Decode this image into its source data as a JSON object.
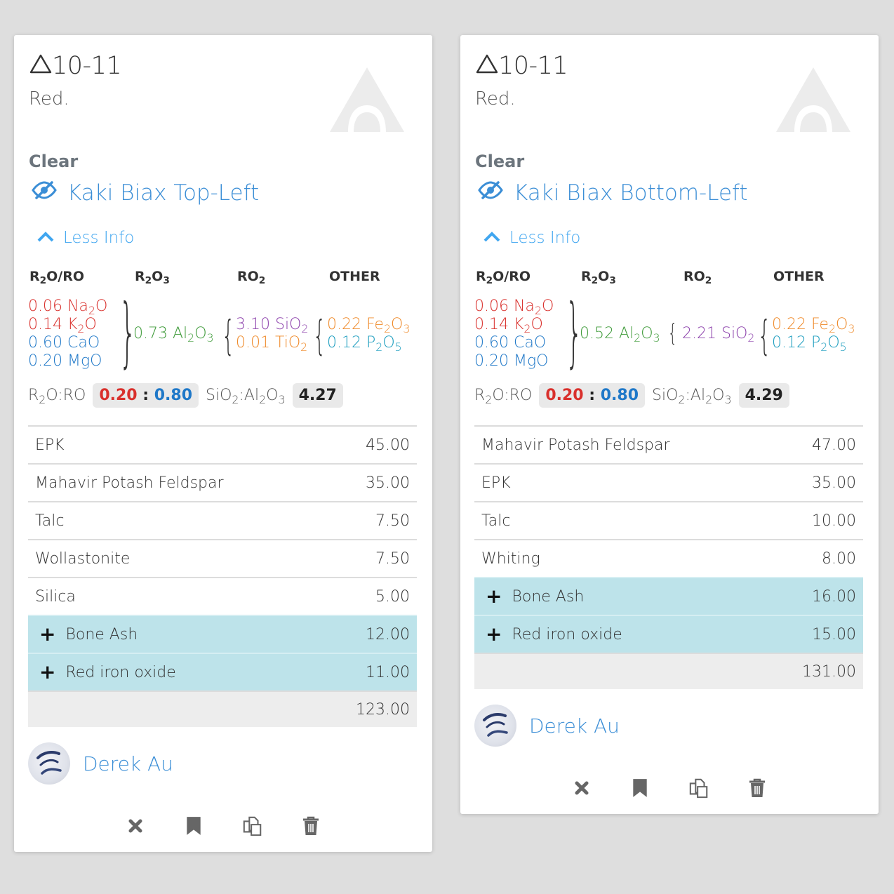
{
  "cards": [
    {
      "cone": "10-11",
      "atmosphere": "Red.",
      "finish": "Clear",
      "name": "Kaki Biax Top-Left",
      "less_info": "Less Info",
      "umf_headers": [
        "R2O/RO",
        "R2O3",
        "RO2",
        "OTHER"
      ],
      "flux": [
        {
          "amount": "0.06",
          "oxide": "Na2O"
        },
        {
          "amount": "0.14",
          "oxide": "K2O"
        },
        {
          "amount": "0.60",
          "oxide": "CaO"
        },
        {
          "amount": "0.20",
          "oxide": "MgO"
        }
      ],
      "r2o3": [
        {
          "amount": "0.73",
          "oxide": "Al2O3"
        }
      ],
      "ro2": [
        {
          "amount": "3.10",
          "oxide": "SiO2"
        },
        {
          "amount": "0.01",
          "oxide": "TiO2"
        }
      ],
      "other": [
        {
          "amount": "0.22",
          "oxide": "Fe2O3"
        },
        {
          "amount": "0.12",
          "oxide": "P2O5"
        }
      ],
      "r2o_ro_label": "R2O:RO",
      "r2o": "0.20",
      "ro": "0.80",
      "si_al_label": "SiO2:Al2O3",
      "si_al": "4.27",
      "materials": [
        {
          "name": "EPK",
          "amount": "45.00"
        },
        {
          "name": "Mahavir Potash Feldspar",
          "amount": "35.00"
        },
        {
          "name": "Talc",
          "amount": "7.50"
        },
        {
          "name": "Wollastonite",
          "amount": "7.50"
        },
        {
          "name": "Silica",
          "amount": "5.00"
        }
      ],
      "additions": [
        {
          "name": "Bone Ash",
          "amount": "12.00"
        },
        {
          "name": "Red iron oxide",
          "amount": "11.00"
        }
      ],
      "total": "123.00",
      "author": "Derek Au"
    },
    {
      "cone": "10-11",
      "atmosphere": "Red.",
      "finish": "Clear",
      "name": "Kaki Biax Bottom-Left",
      "less_info": "Less Info",
      "umf_headers": [
        "R2O/RO",
        "R2O3",
        "RO2",
        "OTHER"
      ],
      "flux": [
        {
          "amount": "0.06",
          "oxide": "Na2O"
        },
        {
          "amount": "0.14",
          "oxide": "K2O"
        },
        {
          "amount": "0.60",
          "oxide": "CaO"
        },
        {
          "amount": "0.20",
          "oxide": "MgO"
        }
      ],
      "r2o3": [
        {
          "amount": "0.52",
          "oxide": "Al2O3"
        }
      ],
      "ro2": [
        {
          "amount": "2.21",
          "oxide": "SiO2"
        }
      ],
      "other": [
        {
          "amount": "0.22",
          "oxide": "Fe2O3"
        },
        {
          "amount": "0.12",
          "oxide": "P2O5"
        }
      ],
      "r2o_ro_label": "R2O:RO",
      "r2o": "0.20",
      "ro": "0.80",
      "si_al_label": "SiO2:Al2O3",
      "si_al": "4.29",
      "materials": [
        {
          "name": "Mahavir Potash Feldspar",
          "amount": "47.00"
        },
        {
          "name": "EPK",
          "amount": "35.00"
        },
        {
          "name": "Talc",
          "amount": "10.00"
        },
        {
          "name": "Whiting",
          "amount": "8.00"
        }
      ],
      "additions": [
        {
          "name": "Bone Ash",
          "amount": "16.00"
        },
        {
          "name": "Red iron oxide",
          "amount": "15.00"
        }
      ],
      "total": "131.00",
      "author": "Derek Au"
    }
  ],
  "icons": {
    "cone": "triangle-icon",
    "logo": "glazy-logo-icon",
    "visibility": "eye-slash-icon",
    "collapse": "chevron-up-icon",
    "add": "plus-icon",
    "actions": [
      "close-icon",
      "bookmark-icon",
      "copy-icon",
      "trash-icon"
    ]
  },
  "colors": {
    "link": "#3b8ed6",
    "r2o": "#d9302c",
    "ro": "#1f78c8",
    "al2o3": "#3f9b3a",
    "sio2": "#8e44ad",
    "colorant": "#ef8a2a",
    "p2o5": "#1a9cbe",
    "addition_row": "#bde3ea"
  }
}
